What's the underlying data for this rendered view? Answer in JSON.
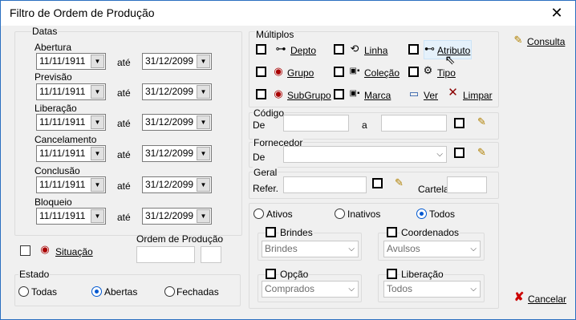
{
  "window": {
    "title": "Filtro de Ordem de Produção",
    "close_icon": "close-icon"
  },
  "datas": {
    "group_label": "Datas",
    "between_label": "até",
    "rows": [
      {
        "label": "Abertura",
        "from": "11/11/1911",
        "to": "31/12/2099"
      },
      {
        "label": "Previsão",
        "from": "11/11/1911",
        "to": "31/12/2099"
      },
      {
        "label": "Liberação",
        "from": "11/11/1911",
        "to": "31/12/2099"
      },
      {
        "label": "Cancelamento",
        "from": "11/11/1911",
        "to": "31/12/2099"
      },
      {
        "label": "Conclusão",
        "from": "11/11/1911",
        "to": "31/12/2099"
      },
      {
        "label": "Bloqueio",
        "from": "11/11/1911",
        "to": "31/12/2099"
      }
    ]
  },
  "situacao": {
    "label": "Situação"
  },
  "ordem": {
    "label": "Ordem de Produção"
  },
  "estado": {
    "group_label": "Estado",
    "options": [
      "Todas",
      "Abertas",
      "Fechadas"
    ],
    "selected": "Abertas"
  },
  "multiplos": {
    "group_label": "Múltiplos",
    "items": [
      "Depto",
      "Linha",
      "Atributo",
      "Grupo",
      "Coleção",
      "Tipo",
      "SubGrupo",
      "Marca"
    ],
    "ver_label": "Ver",
    "limpar_label": "Limpar"
  },
  "codigo": {
    "group_label": "Código",
    "de_label": "De",
    "a_label": "a",
    "de_value": "",
    "a_value": ""
  },
  "fornecedor": {
    "group_label": "Fornecedor",
    "de_label": "De",
    "value": ""
  },
  "geral": {
    "group_label": "Geral",
    "refer_label": "Refer.",
    "cartela_label": "Cartela"
  },
  "status_filter": {
    "options": [
      "Ativos",
      "Inativos",
      "Todos"
    ],
    "selected": "Todos"
  },
  "brindes": {
    "label": "Brindes",
    "value": "Brindes"
  },
  "coordenados": {
    "label": "Coordenados",
    "value": "Avulsos"
  },
  "opcao": {
    "label": "Opção",
    "value": "Comprados"
  },
  "liberacao": {
    "label": "Liberação",
    "value": "Todos"
  },
  "actions": {
    "consulta_label": "Consulta",
    "cancelar_label": "Cancelar"
  }
}
